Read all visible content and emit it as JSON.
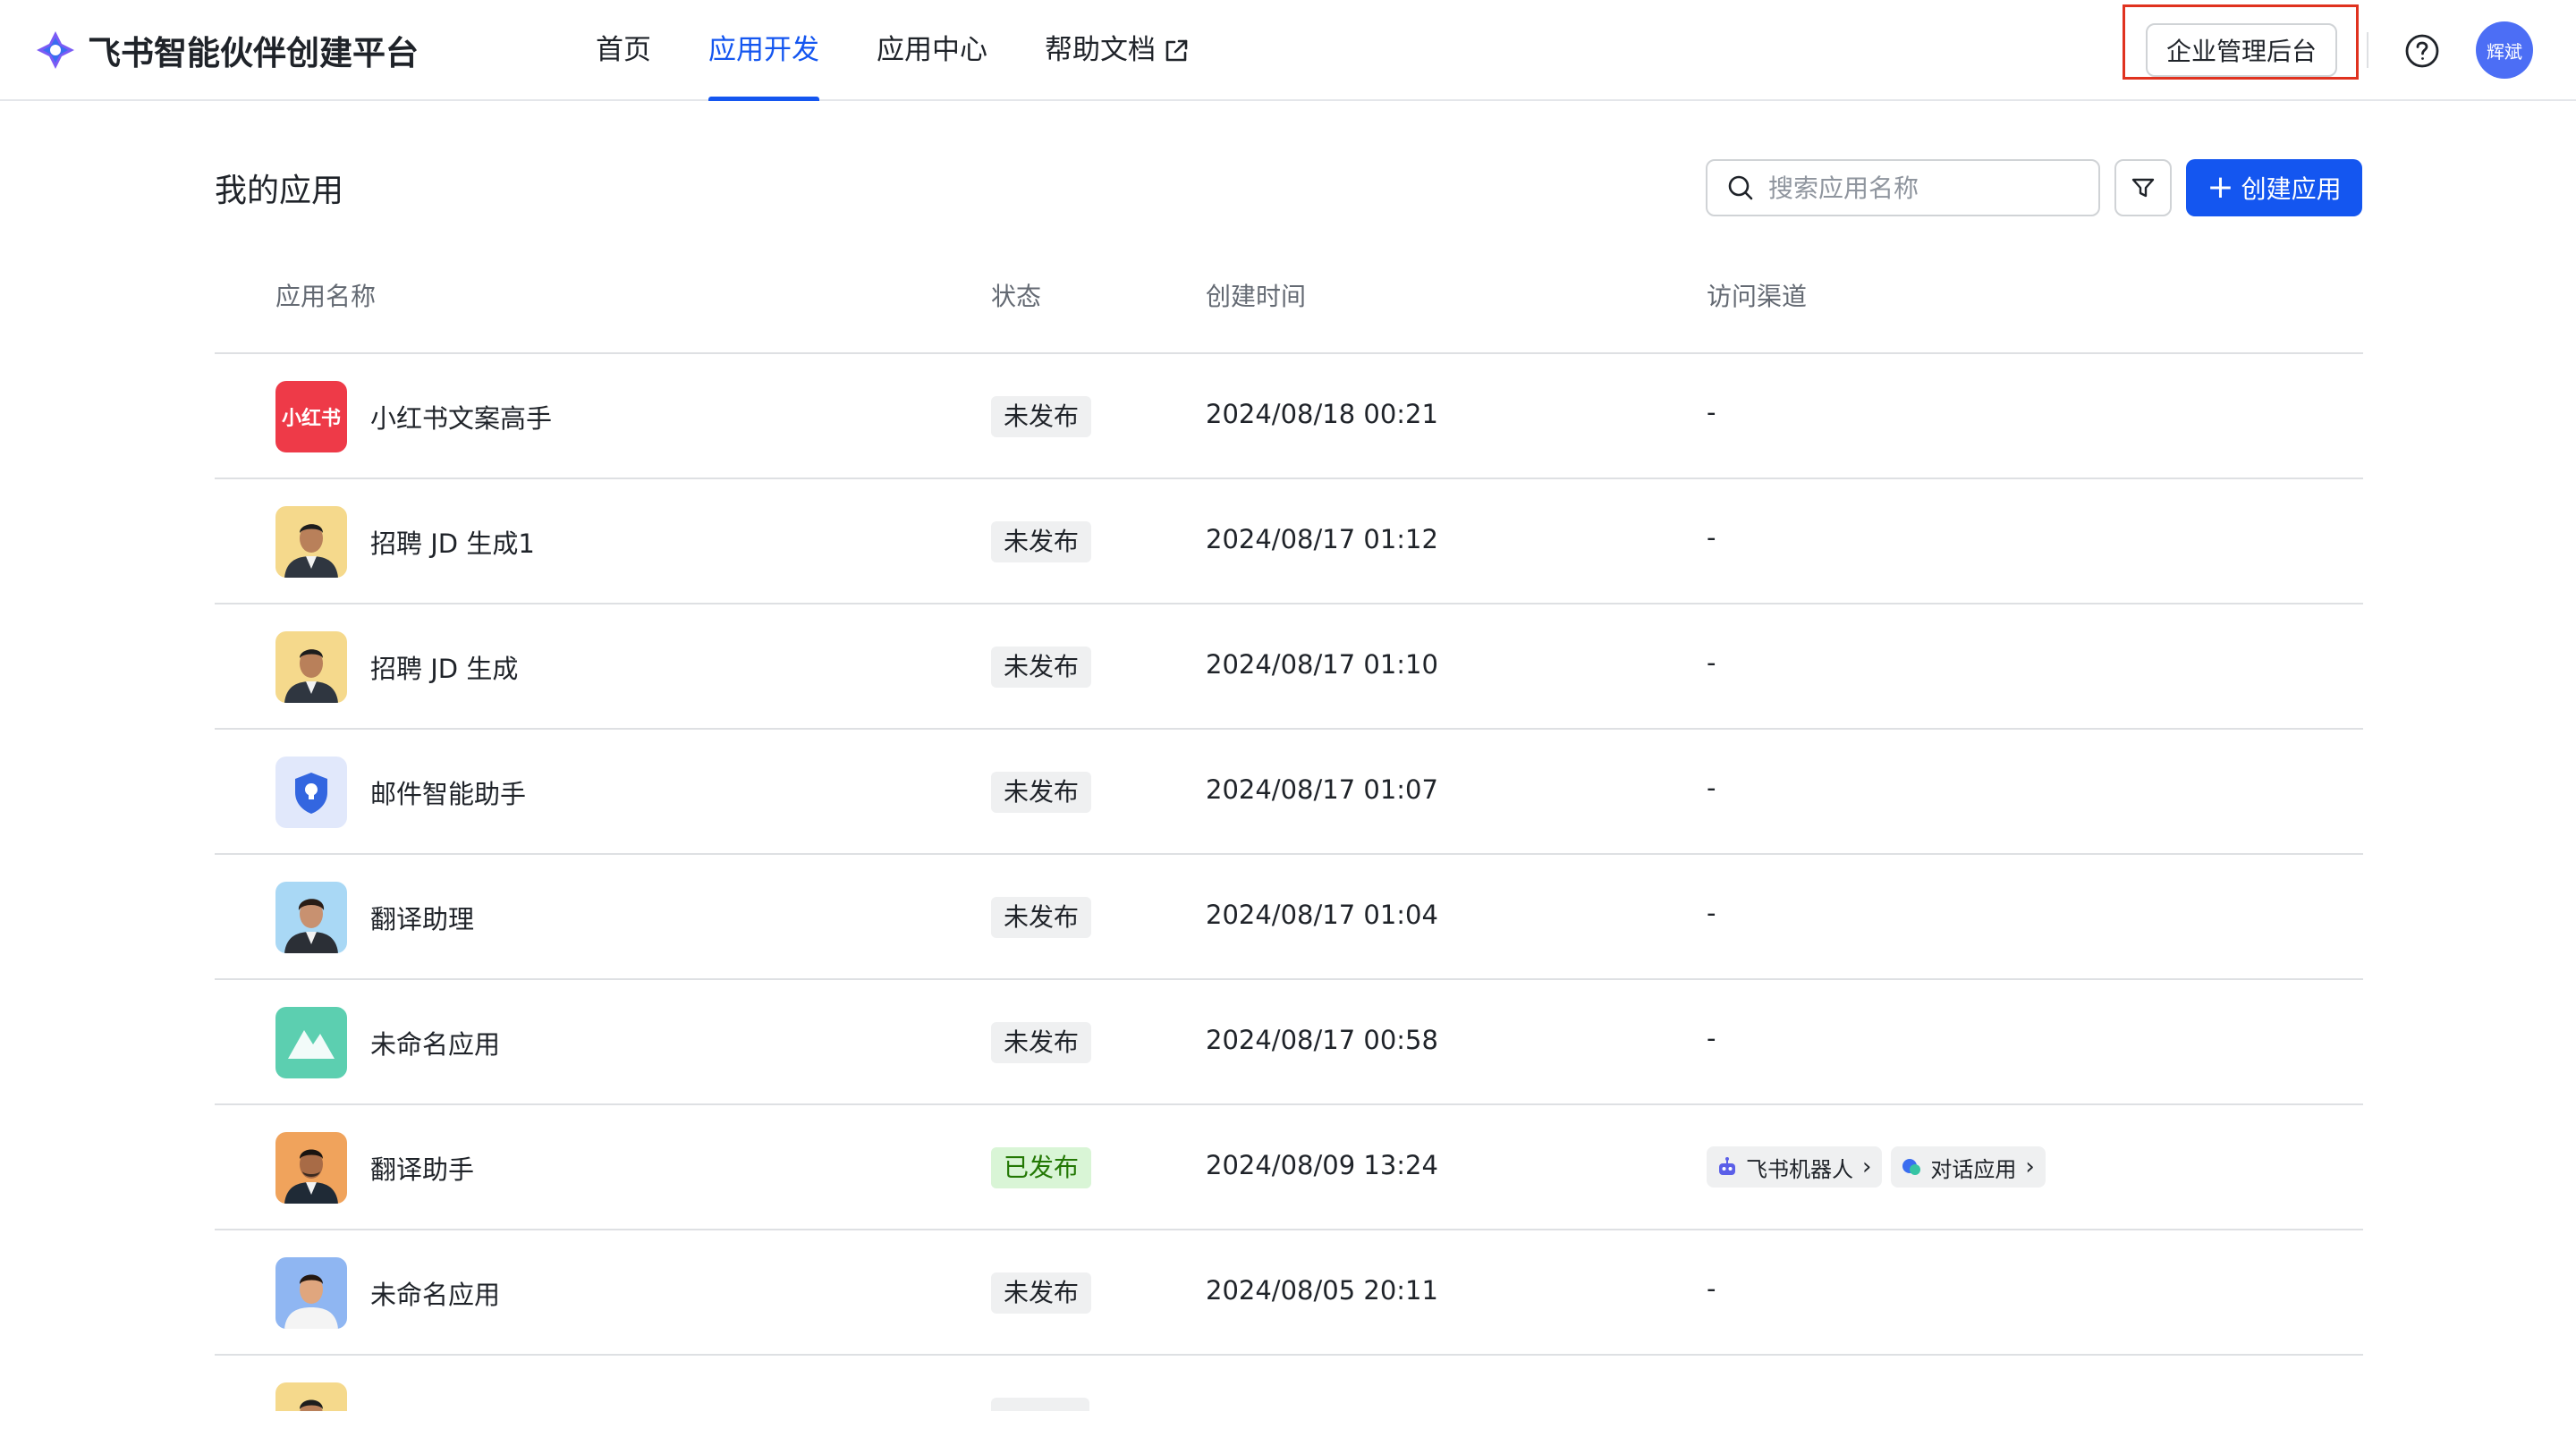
{
  "header": {
    "brand": "飞书智能伙伴创建平台",
    "nav": [
      {
        "label": "首页",
        "active": false
      },
      {
        "label": "应用开发",
        "active": true
      },
      {
        "label": "应用中心",
        "active": false
      },
      {
        "label": "帮助文档",
        "active": false,
        "icon": "external-link-icon"
      }
    ],
    "admin_button": "企业管理后台",
    "help_icon": "question-circle-icon",
    "avatar_text": "辉斌"
  },
  "page": {
    "title": "我的应用",
    "search_placeholder": "搜索应用名称",
    "create_button": "创建应用"
  },
  "table": {
    "columns": [
      "应用名称",
      "状态",
      "创建时间",
      "访问渠道"
    ],
    "rows": [
      {
        "name": "小红书文案高手",
        "icon": "xiaohongshu-logo",
        "status": "未发布",
        "created": "2024/08/18 00:21",
        "channel": "-"
      },
      {
        "name": "招聘 JD 生成1",
        "icon": "person-avatar-yellow",
        "status": "未发布",
        "created": "2024/08/17 01:12",
        "channel": "-"
      },
      {
        "name": "招聘 JD 生成",
        "icon": "person-avatar-yellow",
        "status": "未发布",
        "created": "2024/08/17 01:10",
        "channel": "-"
      },
      {
        "name": "邮件智能助手",
        "icon": "shield-icon",
        "status": "未发布",
        "created": "2024/08/17 01:07",
        "channel": "-"
      },
      {
        "name": "翻译助理",
        "icon": "person-avatar-blue",
        "status": "未发布",
        "created": "2024/08/17 01:04",
        "channel": "-"
      },
      {
        "name": "未命名应用",
        "icon": "mountain-icon",
        "status": "未发布",
        "created": "2024/08/17 00:58",
        "channel": "-"
      },
      {
        "name": "翻译助手",
        "icon": "person-avatar-orange",
        "status": "已发布",
        "created": "2024/08/09 13:24",
        "channel": "",
        "chips": [
          "飞书机器人",
          "对话应用"
        ]
      },
      {
        "name": "未命名应用",
        "icon": "person-avatar-lightblue",
        "status": "未发布",
        "created": "2024/08/05 20:11",
        "channel": "-"
      }
    ]
  },
  "colors": {
    "accent": "#1456f0",
    "highlight_box": "#e0321f",
    "published_bg": "#d9f5d6",
    "unpublished_bg": "#eff0f1"
  }
}
